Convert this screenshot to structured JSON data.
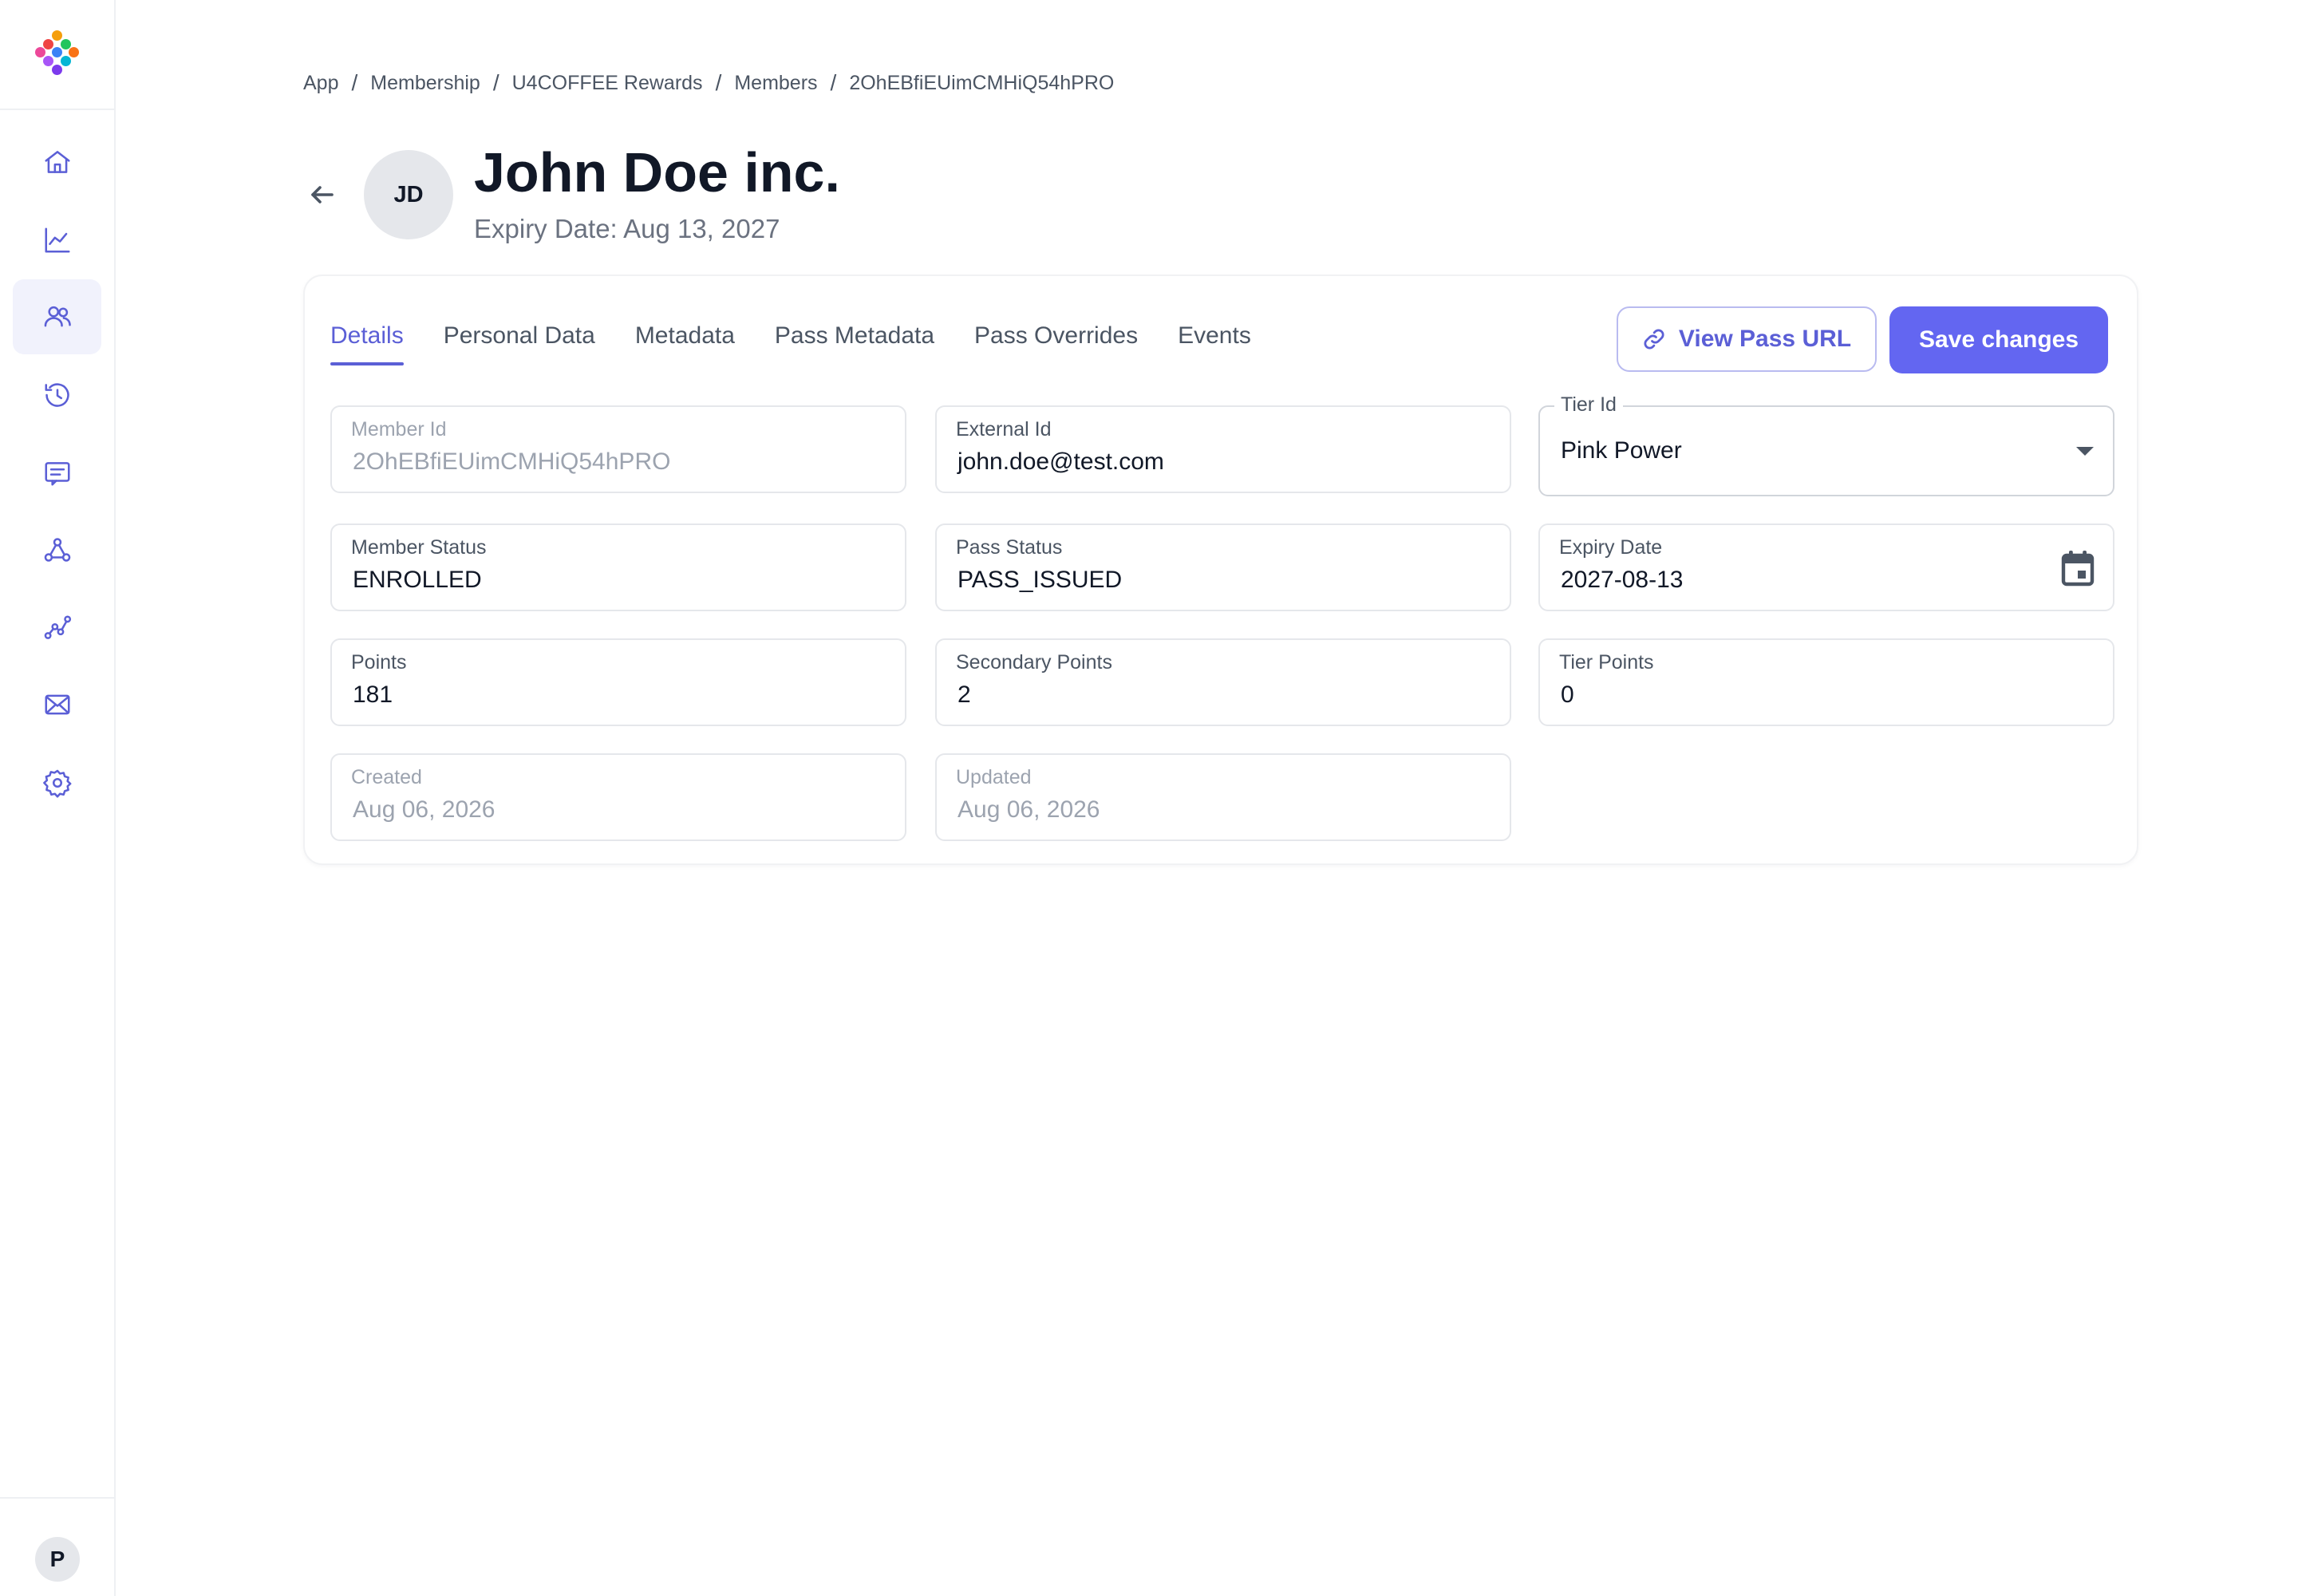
{
  "sidebar": {
    "nav": [
      {
        "name": "home-icon"
      },
      {
        "name": "chart-line-icon"
      },
      {
        "name": "users-icon",
        "active": true
      },
      {
        "name": "history-icon"
      },
      {
        "name": "message-icon"
      },
      {
        "name": "webhook-icon"
      },
      {
        "name": "trend-icon"
      },
      {
        "name": "mail-icon"
      },
      {
        "name": "settings-icon"
      }
    ],
    "user_initial": "P"
  },
  "breadcrumb": [
    "App",
    "Membership",
    "U4COFFEE Rewards",
    "Members",
    "2OhEBfiEUimCMHiQ54hPRO"
  ],
  "header": {
    "initials": "JD",
    "title": "John Doe inc.",
    "subtitle": "Expiry Date: Aug 13, 2027"
  },
  "tabs": [
    "Details",
    "Personal Data",
    "Metadata",
    "Pass Metadata",
    "Pass Overrides",
    "Events"
  ],
  "active_tab": "Details",
  "actions": {
    "view_pass_url": "View Pass URL",
    "save_changes": "Save changes"
  },
  "fields": {
    "member_id": {
      "label": "Member Id",
      "value": "2OhEBfiEUimCMHiQ54hPRO"
    },
    "external_id": {
      "label": "External Id",
      "value": "john.doe@test.com"
    },
    "tier_id": {
      "label": "Tier Id",
      "value": "Pink Power"
    },
    "member_status": {
      "label": "Member Status",
      "value": "ENROLLED"
    },
    "pass_status": {
      "label": "Pass Status",
      "value": "PASS_ISSUED"
    },
    "expiry_date": {
      "label": "Expiry Date",
      "value": "2027-08-13"
    },
    "points": {
      "label": "Points",
      "value": "181"
    },
    "secondary_points": {
      "label": "Secondary Points",
      "value": "2"
    },
    "tier_points": {
      "label": "Tier Points",
      "value": "0"
    },
    "created": {
      "label": "Created",
      "value": "Aug 06, 2026"
    },
    "updated": {
      "label": "Updated",
      "value": "Aug 06, 2026"
    }
  },
  "colors": {
    "accent": "#6366f1",
    "accent_text": "#5b5fd6"
  }
}
